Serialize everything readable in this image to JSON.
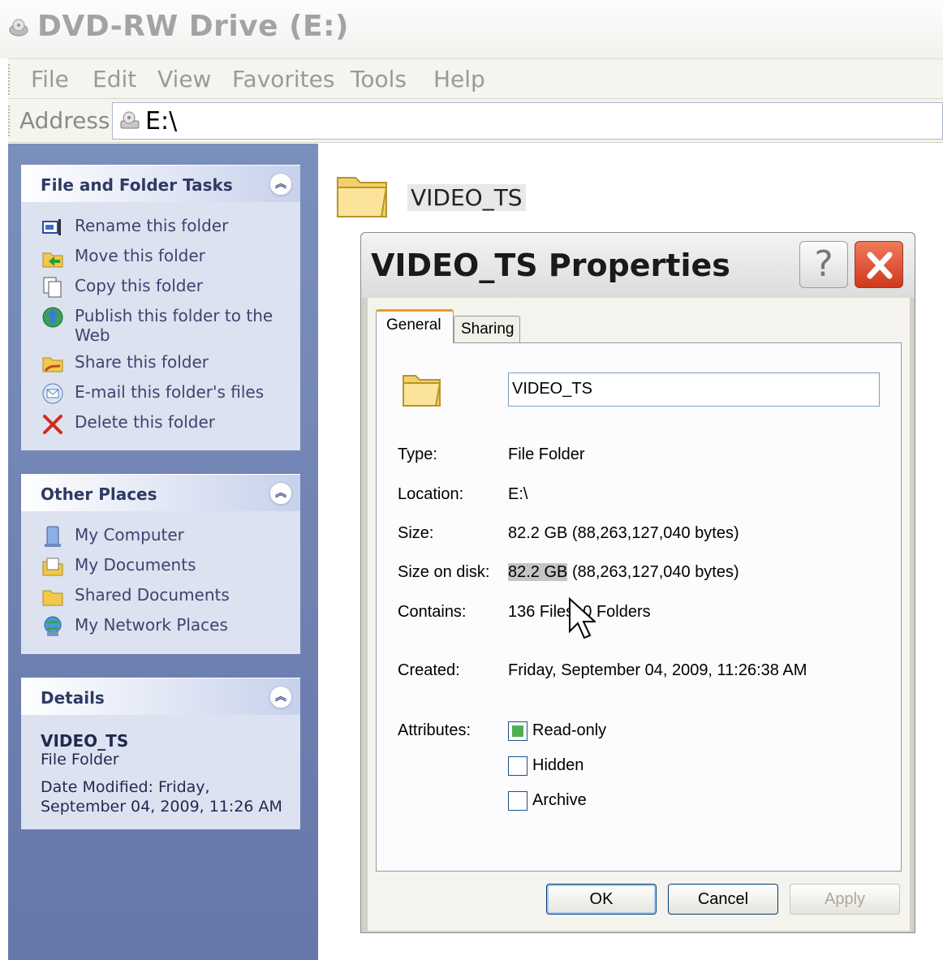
{
  "window": {
    "title": "DVD-RW Drive (E:)",
    "icon": "cd-drive-icon"
  },
  "menu": [
    "File",
    "Edit",
    "View",
    "Favorites",
    "Tools",
    "Help"
  ],
  "address": {
    "label": "Address",
    "value": "E:\\",
    "icon": "cd-drive-icon"
  },
  "tasks_panel": {
    "title": "File and Folder Tasks",
    "items": [
      {
        "label": "Rename this folder",
        "icon": "rename-icon"
      },
      {
        "label": "Move this folder",
        "icon": "move-icon"
      },
      {
        "label": "Copy this folder",
        "icon": "copy-icon"
      },
      {
        "label": "Publish this folder to the Web",
        "icon": "publish-web-icon"
      },
      {
        "label": "Share this folder",
        "icon": "share-icon"
      },
      {
        "label": "E-mail this folder's files",
        "icon": "email-icon"
      },
      {
        "label": "Delete this folder",
        "icon": "delete-icon"
      }
    ]
  },
  "places_panel": {
    "title": "Other Places",
    "items": [
      {
        "label": "My Computer",
        "icon": "computer-icon"
      },
      {
        "label": "My Documents",
        "icon": "documents-icon"
      },
      {
        "label": "Shared Documents",
        "icon": "folder-icon"
      },
      {
        "label": "My Network Places",
        "icon": "network-icon"
      }
    ]
  },
  "details_panel": {
    "title": "Details",
    "name": "VIDEO_TS",
    "type": "File Folder",
    "modified_line1": "Date Modified: Friday,",
    "modified_line2": "September 04, 2009, 11:26 AM"
  },
  "folder": {
    "name": "VIDEO_TS"
  },
  "dialog": {
    "title": "VIDEO_TS Properties",
    "help_label": "?",
    "tabs": [
      "General",
      "Sharing"
    ],
    "name_value": "VIDEO_TS",
    "props": {
      "type_label": "Type:",
      "type_value": "File Folder",
      "location_label": "Location:",
      "location_value": "E:\\",
      "size_label": "Size:",
      "size_value": "82.2 GB (88,263,127,040 bytes)",
      "size_on_disk_label": "Size on disk:",
      "size_on_disk_highlight": "82.2 GB",
      "size_on_disk_rest": " (88,263,127,040 bytes)",
      "contains_label": "Contains:",
      "contains_value": "136 Files, 0 Folders",
      "created_label": "Created:",
      "created_value": "Friday, September 04, 2009, 11:26:38 AM",
      "attributes_label": "Attributes:"
    },
    "attributes": [
      {
        "label": "Read-only",
        "checked": true
      },
      {
        "label": "Hidden",
        "checked": false
      },
      {
        "label": "Archive",
        "checked": false
      }
    ],
    "buttons": {
      "ok": "OK",
      "cancel": "Cancel",
      "apply": "Apply"
    }
  },
  "colors": {
    "taskpane_bg": "#6f81b4",
    "panel_bg": "#dde2f0",
    "tab_accent": "#e69e28",
    "close_red": "#d0381c"
  }
}
